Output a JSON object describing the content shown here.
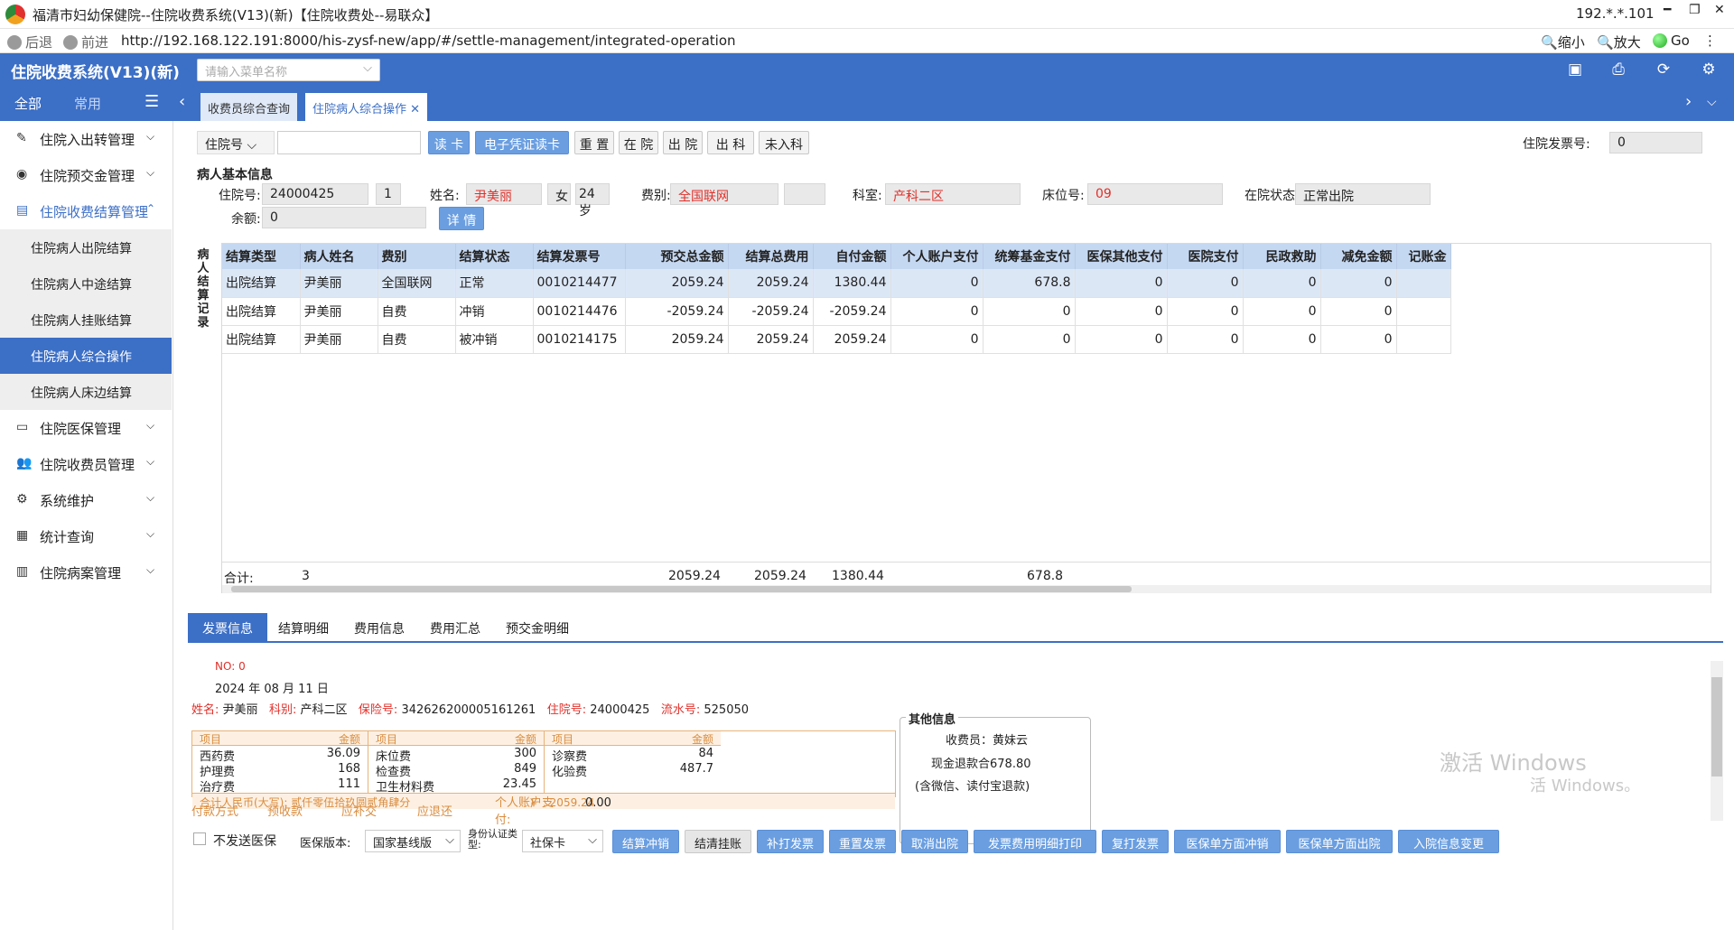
{
  "window": {
    "title": "福清市妇幼保健院--住院收费系统(V13)(新)【住院收费处--易联众】",
    "ip": "192.*.*.101"
  },
  "browser": {
    "back": "后退",
    "forward": "前进",
    "url": "http://192.168.122.191:8000/his-zysf-new/app/#/settle-management/integrated-operation",
    "zoom_out": "缩小",
    "zoom_in": "放大",
    "go": "Go"
  },
  "app": {
    "title": "住院收费系统(V13)(新)",
    "menu_search_placeholder": "请输入菜单名称"
  },
  "sidebar": {
    "tab_all": "全部",
    "tab_common": "常用",
    "items": [
      {
        "label": "住院入出转管理",
        "icon": "pencil-square-icon"
      },
      {
        "label": "住院预交金管理",
        "icon": "coin-icon"
      },
      {
        "label": "住院收费结算管理",
        "icon": "document-icon",
        "open": true
      },
      {
        "label": "住院医保管理",
        "icon": "card-icon"
      },
      {
        "label": "住院收费员管理",
        "icon": "users-icon"
      },
      {
        "label": "系统维护",
        "icon": "gear-icon"
      },
      {
        "label": "统计查询",
        "icon": "chart-icon"
      },
      {
        "label": "住院病案管理",
        "icon": "book-icon"
      }
    ],
    "subitems": [
      "住院病人出院结算",
      "住院病人中途结算",
      "住院病人挂账结算",
      "住院病人综合操作",
      "住院病人床边结算"
    ]
  },
  "tabs": [
    "收费员综合查询",
    "住院病人综合操作"
  ],
  "toolbar": {
    "hospno_label": "住院号",
    "buttons": [
      "读 卡",
      "电子凭证读卡",
      "重 置",
      "在 院",
      "出 院",
      "出 科",
      "未入科"
    ],
    "invoice_label": "住院发票号:",
    "invoice_value": "0"
  },
  "patient": {
    "section": "病人基本信息",
    "hospno_label": "住院号:",
    "hospno": "24000425",
    "times": "1",
    "name_label": "姓名:",
    "name": "尹美丽",
    "sex": "女",
    "age": "24岁",
    "fee_label": "费别:",
    "fee": "全国联网",
    "dept_label": "科室:",
    "dept": "产科二区",
    "bed_label": "床位号:",
    "bed": "09",
    "status_label": "在院状态:",
    "status": "正常出院",
    "balance_label": "余额:",
    "balance": "0",
    "detail_btn": "详 情"
  },
  "grid": {
    "vertical_label": "病人结算记录",
    "columns": [
      "结算类型",
      "病人姓名",
      "费别",
      "结算状态",
      "结算发票号",
      "预交总金额",
      "结算总费用",
      "自付金额",
      "个人账户支付",
      "统筹基金支付",
      "医保其他支付",
      "医院支付",
      "民政救助",
      "减免金额",
      "记账金"
    ],
    "rows": [
      [
        "出院结算",
        "尹美丽",
        "全国联网",
        "正常",
        "0010214477",
        "2059.24",
        "2059.24",
        "1380.44",
        "0",
        "678.8",
        "0",
        "0",
        "0",
        "0",
        ""
      ],
      [
        "出院结算",
        "尹美丽",
        "自费",
        "冲销",
        "0010214476",
        "-2059.24",
        "-2059.24",
        "-2059.24",
        "0",
        "0",
        "0",
        "0",
        "0",
        "0",
        ""
      ],
      [
        "出院结算",
        "尹美丽",
        "自费",
        "被冲销",
        "0010214175",
        "2059.24",
        "2059.24",
        "2059.24",
        "0",
        "0",
        "0",
        "0",
        "0",
        "0",
        ""
      ]
    ],
    "total_label": "合计:",
    "total_count": "3",
    "total_prepay": "2059.24",
    "total_fee": "2059.24",
    "total_self": "1380.44",
    "total_fund": "678.8"
  },
  "bottom_tabs": [
    "发票信息",
    "结算明细",
    "费用信息",
    "费用汇总",
    "预交金明细"
  ],
  "invoice": {
    "no": "NO: 0",
    "date": "2024 年 08 月 11 日",
    "name_label": "姓名:",
    "name": "尹美丽",
    "dept_label": "科别:",
    "dept": "产科二区",
    "ins_label": "保险号:",
    "ins": "342626200005161261",
    "hosp_label": "住院号:",
    "hosp": "24000425",
    "serial_label": "流水号:",
    "serial": "525050",
    "col_item": "项目",
    "col_amount": "金额",
    "items": [
      [
        [
          "西药费",
          "36.09"
        ],
        [
          "护理费",
          "168"
        ],
        [
          "治疗费",
          "111"
        ]
      ],
      [
        [
          "床位费",
          "300"
        ],
        [
          "检查费",
          "849"
        ],
        [
          "卫生材料费",
          "23.45"
        ]
      ],
      [
        [
          "诊察费",
          "84"
        ],
        [
          "化验费",
          "487.7"
        ]
      ]
    ],
    "total_cn_label": "合计人民币(大写):",
    "total_cn": "贰仟零伍拾玖圆贰角肆分",
    "total_num": "￥ : 2059.24",
    "pay_method": "付款方式",
    "prepay": "预收款",
    "should_pay": "应补交",
    "should_refund": "应退还",
    "personal_account": "个人账户支付:",
    "personal_value": "0.00",
    "other_title": "其他信息",
    "cashier": "收费员：黄妹云",
    "cash_refund": "现金退款合678.80",
    "cash_note": "(含微信、读付宝退款)"
  },
  "bottombar": {
    "no_send": "不发送医保",
    "version_label": "医保版本:",
    "version": "国家基线版",
    "id_label": "身份认证类型:",
    "id_value": "社保卡",
    "buttons": [
      "结算冲销",
      "结清挂账",
      "补打发票",
      "重置发票",
      "取消出院",
      "发票费用明细打印",
      "复打发票",
      "医保单方面冲销",
      "医保单方面出院",
      "入院信息变更"
    ]
  },
  "watermark": {
    "line1": "激活 Windows",
    "line2": "活 Windows。"
  }
}
